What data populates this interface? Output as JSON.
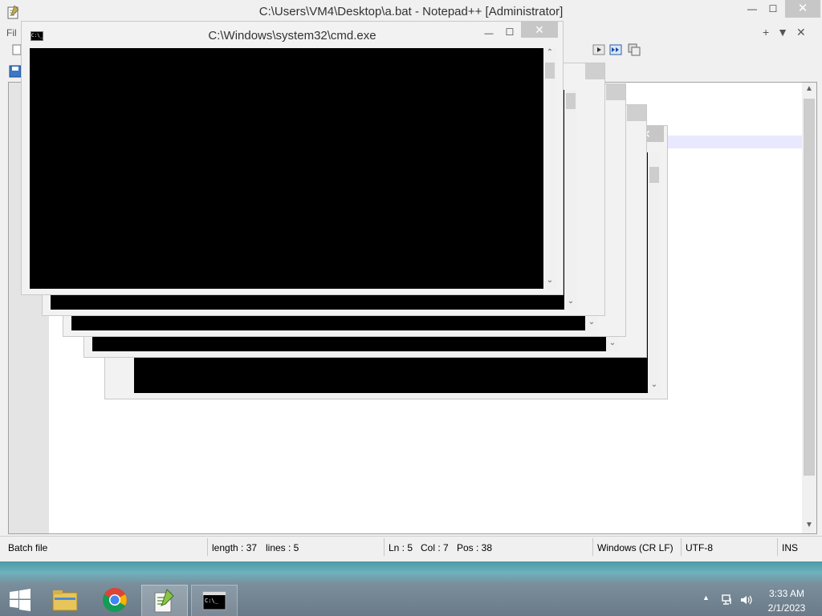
{
  "notepadpp": {
    "title": "C:\\Users\\VM4\\Desktop\\a.bat - Notepad++ [Administrator]",
    "menu_partial": "Fil",
    "min_glyph": "—",
    "max_glyph": "☐",
    "close_glyph": "✕",
    "tab_controls": "+▼✕",
    "status": {
      "file_type": "Batch file",
      "length": "length : 37",
      "lines": "lines : 5",
      "ln": "Ln : 5",
      "col": "Col : 7",
      "pos": "Pos : 38",
      "eol": "Windows (CR LF)",
      "encoding": "UTF-8",
      "mode": "INS"
    }
  },
  "cmd": {
    "title": "C:\\Windows\\system32\\cmd.exe",
    "icon_text": "C:\\_",
    "min_glyph": "—",
    "max_glyph": "☐",
    "close_glyph": "✕"
  },
  "taskbar": {
    "time": "3:33 AM",
    "date": "2/1/2023",
    "tray_arrow": "▲"
  },
  "colors": {
    "console_bg": "#000000",
    "close_button": "#c7c7c7",
    "taskbar_top": "#4c9aa7"
  }
}
